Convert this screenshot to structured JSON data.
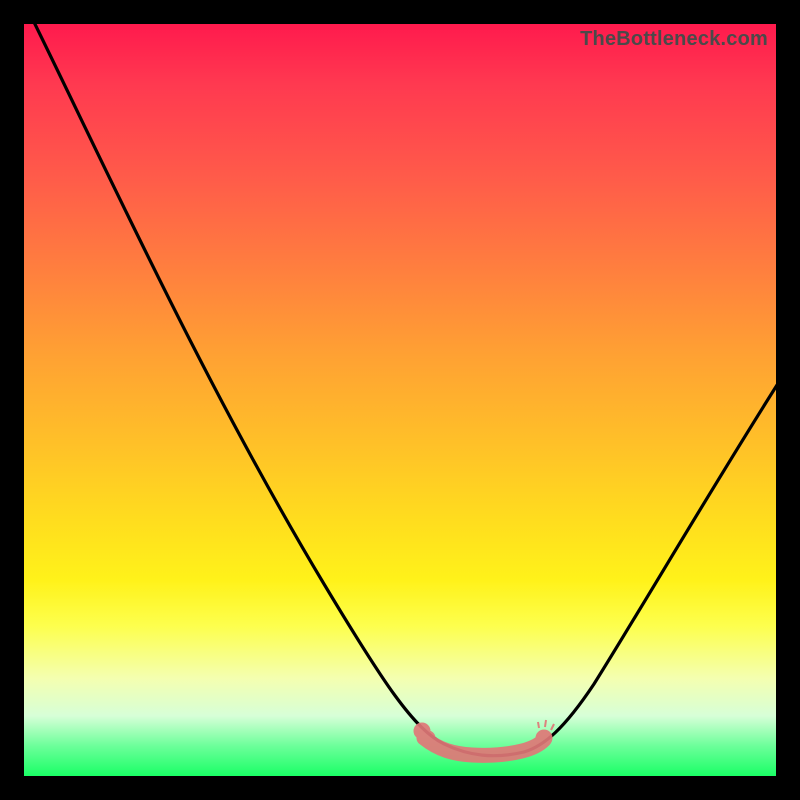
{
  "watermark": "TheBottleneck.com",
  "chart_data": {
    "type": "line",
    "title": "",
    "xlabel": "",
    "ylabel": "",
    "xlim": [
      0,
      100
    ],
    "ylim": [
      0,
      100
    ],
    "series": [
      {
        "name": "bottleneck-curve",
        "x": [
          0,
          5,
          10,
          15,
          20,
          25,
          30,
          35,
          40,
          45,
          50,
          53,
          56,
          60,
          63,
          66,
          70,
          75,
          80,
          85,
          90,
          95,
          100
        ],
        "y": [
          100,
          92,
          83,
          74,
          65,
          56,
          47,
          38,
          29,
          20,
          12,
          7,
          4,
          2,
          2,
          3,
          6,
          12,
          19,
          27,
          35,
          44,
          53
        ]
      },
      {
        "name": "flat-highlight",
        "x": [
          53,
          56,
          58,
          60,
          62,
          64,
          66,
          68
        ],
        "y": [
          7,
          4.5,
          3,
          2.2,
          2,
          2.5,
          3.5,
          5
        ]
      }
    ],
    "colors": {
      "curve": "#000000",
      "highlight": "#e17a7a",
      "gradient_top": "#ff1a4d",
      "gradient_bottom": "#1aff66"
    }
  }
}
